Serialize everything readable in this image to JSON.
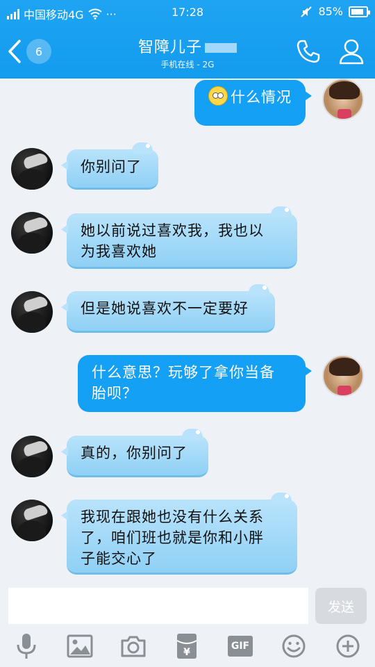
{
  "status_bar": {
    "carrier": "中国移动4G",
    "more": "···",
    "time": "17:28",
    "battery_text": "85%",
    "battery_level": 0.85,
    "icons": [
      "signal-icon",
      "wifi-icon",
      "mute-icon",
      "battery-icon"
    ]
  },
  "header": {
    "back_badge": "6",
    "title": "智障儿子",
    "subtitle": "手机在线 - 2G",
    "icons": [
      "back-chevron-icon",
      "phone-icon",
      "profile-icon"
    ],
    "colors": {
      "bar": "#139bee",
      "outgoing_bubble": "#14a0f5",
      "incoming_bubble": "#a8dcfa"
    }
  },
  "messages": [
    {
      "from": "me",
      "emoji": "eye-roll-emoji",
      "text": "什么情况"
    },
    {
      "from": "friend",
      "text": "你别问了"
    },
    {
      "from": "friend",
      "text": [
        "她以前说过喜欢我，我也以",
        "为我喜欢她"
      ]
    },
    {
      "from": "friend",
      "text": "但是她说喜欢不一定要好"
    },
    {
      "from": "me",
      "text": [
        "什么意思？玩够了拿你当备",
        "胎呗？"
      ]
    },
    {
      "from": "friend",
      "text": "真的，你别问了"
    },
    {
      "from": "friend",
      "text": [
        "我现在跟她也没有什么关系",
        "了，咱们班也就是你和小胖",
        "子能交心了"
      ]
    }
  ],
  "input": {
    "value": "",
    "send_label": "发送"
  },
  "toolbar": {
    "gif_label": "GIF",
    "icons": [
      "microphone-icon",
      "image-icon",
      "camera-icon",
      "red-packet-icon",
      "gif-icon",
      "emoji-icon",
      "plus-icon"
    ]
  }
}
